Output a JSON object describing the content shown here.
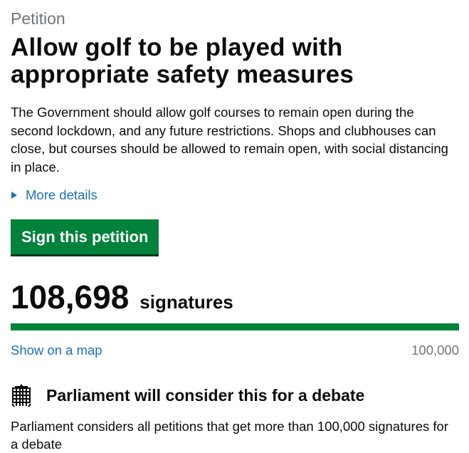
{
  "petition": {
    "caption": "Petition",
    "title": "Allow golf to be played with appropriate safety measures",
    "description": "The Government should allow golf courses to remain open during the second lockdown, and any future restrictions. Shops and clubhouses can close, but courses should be allowed to remain open, with social distancing in place.",
    "more_details_label": "More details",
    "sign_button_label": "Sign this petition"
  },
  "signatures": {
    "count": "108,698",
    "label": "signatures",
    "progress_fraction": 1.0,
    "map_link_label": "Show on a map",
    "threshold_label": "100,000"
  },
  "debate": {
    "icon": "portcullis-icon",
    "title": "Parliament will consider this for a debate",
    "text": "Parliament considers all petitions that get more than 100,000 signatures for a debate"
  },
  "colors": {
    "link": "#1d70b8",
    "button": "#00823b",
    "progress": "#00823b",
    "muted_text": "#6f777b"
  }
}
